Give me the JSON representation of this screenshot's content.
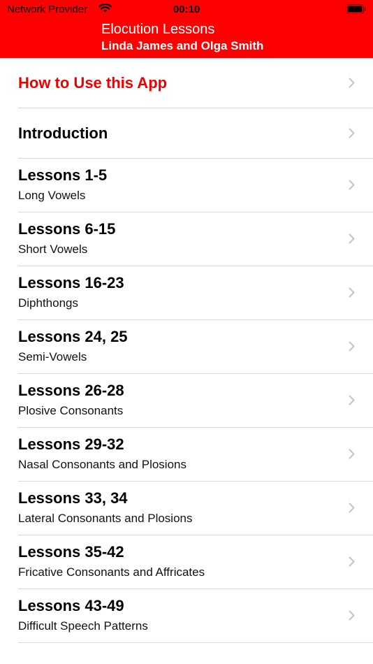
{
  "status_bar": {
    "carrier": "Network Provider",
    "time": "00:10",
    "wifi_icon": "wifi-icon",
    "battery_icon": "battery-icon"
  },
  "nav": {
    "title": "Elocution Lessons",
    "subtitle": "Linda James and Olga Smith"
  },
  "colors": {
    "header_bg": "#ff0000",
    "accent_text": "#ee0000",
    "chevron": "#c4c4c7"
  },
  "items": [
    {
      "title": "How to Use this App",
      "subtitle": ""
    },
    {
      "title": "Introduction",
      "subtitle": ""
    },
    {
      "title": "Lessons 1-5",
      "subtitle": "Long Vowels"
    },
    {
      "title": "Lessons 6-15",
      "subtitle": "Short Vowels"
    },
    {
      "title": "Lessons 16-23",
      "subtitle": "Diphthongs"
    },
    {
      "title": "Lessons 24, 25",
      "subtitle": "Semi-Vowels"
    },
    {
      "title": "Lessons 26-28",
      "subtitle": "Plosive Consonants"
    },
    {
      "title": "Lessons 29-32",
      "subtitle": "Nasal Consonants and Plosions"
    },
    {
      "title": "Lessons 33, 34",
      "subtitle": "Lateral Consonants and Plosions"
    },
    {
      "title": "Lessons 35-42",
      "subtitle": "Fricative Consonants and Affricates"
    },
    {
      "title": "Lessons 43-49",
      "subtitle": "Difficult Speech Patterns"
    }
  ]
}
